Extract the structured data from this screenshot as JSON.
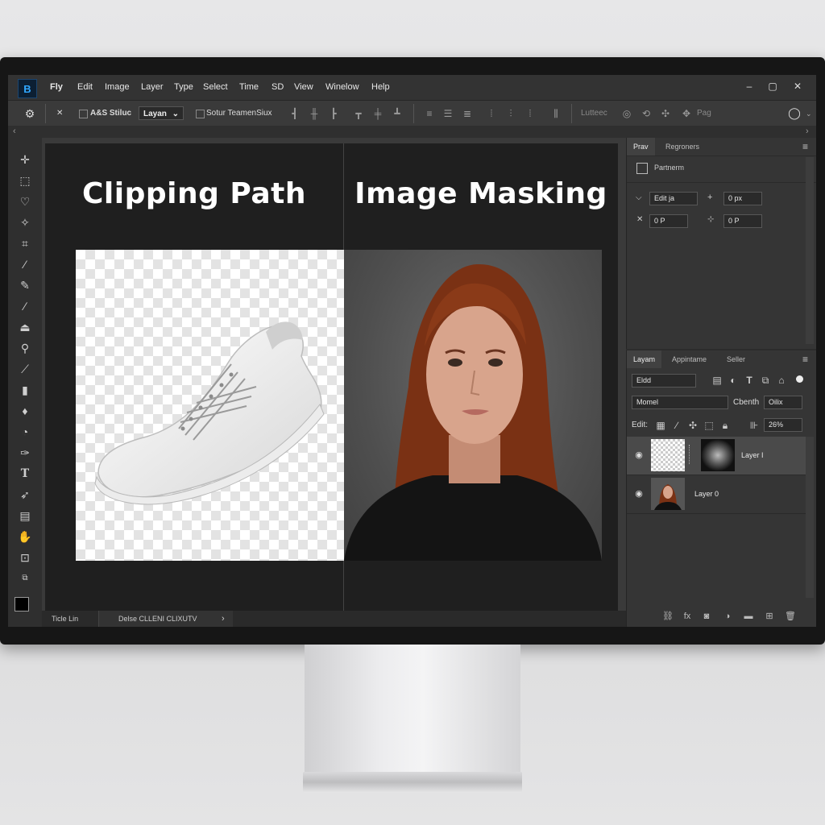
{
  "app": {
    "logo": "B"
  },
  "menu": [
    "Fly",
    "Edit",
    "Image",
    "Layer",
    "Type",
    "Select",
    "Time",
    "SD",
    "View",
    "Winelow",
    "Help"
  ],
  "window_controls": {
    "minimize": "–",
    "maximize": "▢",
    "close": "✕"
  },
  "options": {
    "close_mark": "✕",
    "style_label": "A&S Stiluc",
    "layer_select": "Layan",
    "team_label": "Sotur TeamenSiux",
    "right_label": "Lutteec",
    "bag_label": "Pag",
    "chevron": "⌄"
  },
  "tabstrip": {
    "left_arrow": "‹",
    "right_arrow": "›"
  },
  "canvas": {
    "left_heading": "Clipping Path",
    "right_heading": "Image Masking"
  },
  "status": {
    "left_text": "Ticle Lin",
    "center_text": "Delse CLLENI CLIXUTV",
    "arrow": "›"
  },
  "properties_panel": {
    "tabs": [
      "Prav",
      "Regroners"
    ],
    "menu": "≡",
    "section": "Partnerm",
    "fields": [
      {
        "label": "Edit ja",
        "value_x": "0 px"
      },
      {
        "label": "0 P",
        "value_x": "0 P"
      }
    ]
  },
  "layers_panel": {
    "tabs": [
      "Layam",
      "Appintame",
      "Seller"
    ],
    "menu": "≡",
    "kind_filter": "Eldd",
    "blend_mode": "Momel",
    "opacity_label": "Cbenth",
    "opacity_value": "Oilix",
    "edit_label": "Edit:",
    "fill_value": "26%",
    "layers": [
      {
        "name": "Layer I",
        "selected": true,
        "eye": "◉"
      },
      {
        "name": "Layer 0",
        "selected": false,
        "eye": "◉"
      }
    ]
  },
  "colors": {
    "accent": "#31a8ff",
    "panel": "#353535",
    "canvas_bg": "#1f1f1f"
  }
}
